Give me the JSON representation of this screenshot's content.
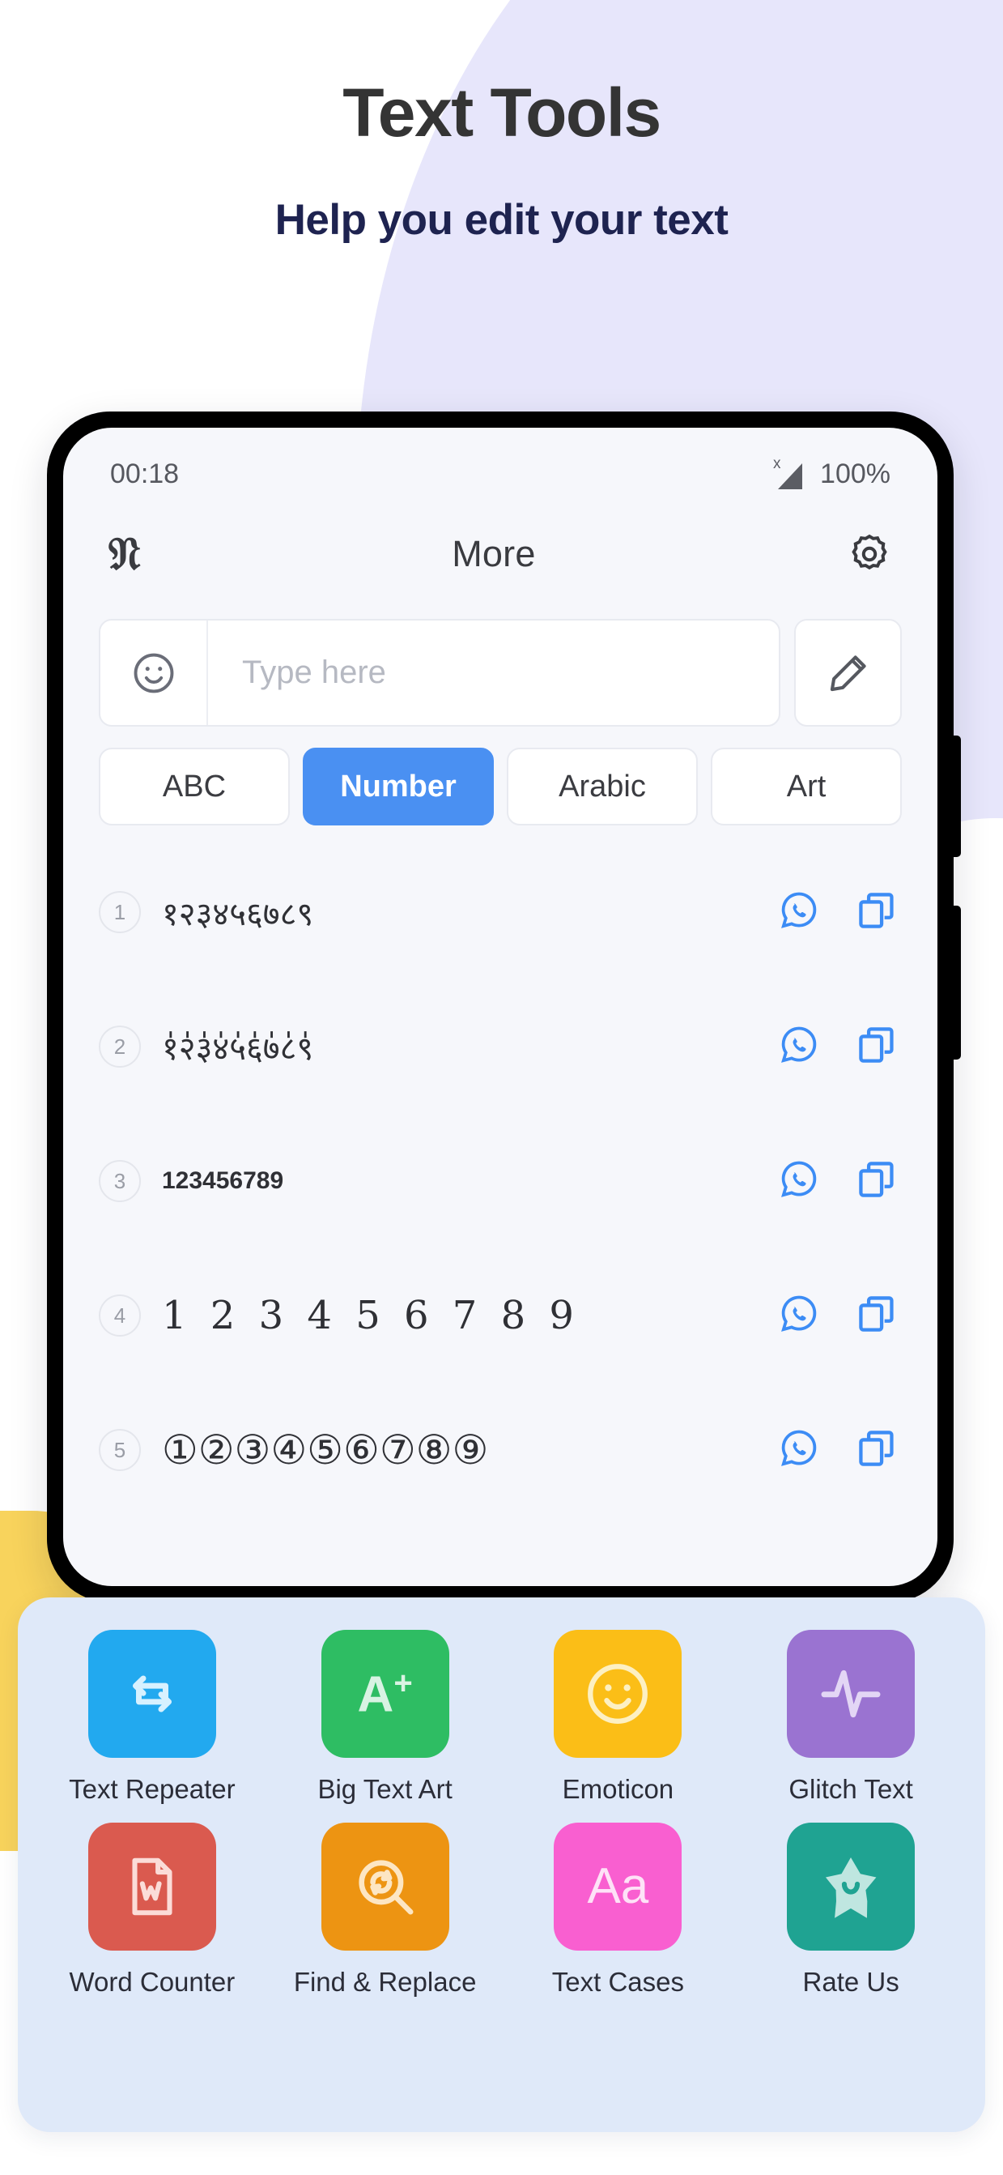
{
  "promo": {
    "headline": "Text Tools",
    "subhead": "Help you edit your text",
    "headline_color": "#343434",
    "subhead_color": "#1e2350",
    "bg_lavender": "#e7e6fb",
    "bg_yellow": "#f8d35c"
  },
  "status_bar": {
    "time": "00:18",
    "battery": "100%",
    "signal_icon": "signal-bars-icon",
    "signal_badge": "x"
  },
  "app_bar": {
    "logo": "F",
    "logo_icon": "fraktur-f-logo-icon",
    "title": "More",
    "settings_icon": "gear-icon"
  },
  "input": {
    "emoji_icon": "smiley-face-icon",
    "placeholder": "Type here",
    "value": "",
    "edit_icon": "pencil-icon"
  },
  "tabs": [
    {
      "label": "ABC",
      "active": false
    },
    {
      "label": "Number",
      "active": true
    },
    {
      "label": "Arabic",
      "active": false
    },
    {
      "label": "Art",
      "active": false
    }
  ],
  "tab_active_color": "#4a90f2",
  "rows": [
    {
      "index": "1",
      "text": "१२३४५६७८९",
      "style": "rt-deva"
    },
    {
      "index": "2",
      "text": "१॑२॑३॑४॑५॑६॑७॑८॑९॑",
      "style": "rt-deva2"
    },
    {
      "index": "3",
      "text": "123456789",
      "style": "rt-small"
    },
    {
      "index": "4",
      "text": "1 2 3 4 5 6 7 8 9",
      "style": "rt-serif"
    },
    {
      "index": "5",
      "text": "①②③④⑤⑥⑦⑧⑨",
      "style": "rt-circled"
    }
  ],
  "row_actions": {
    "whatsapp_icon": "whatsapp-share-icon",
    "copy_icon": "copy-icon",
    "action_color": "#3c8cf5"
  },
  "tools_panel": {
    "background": "#dfe9f9",
    "tools": [
      {
        "label": "Text Repeater",
        "icon": "repeat-arrows-icon",
        "color": "#22a9ef"
      },
      {
        "label": "Big Text Art",
        "icon": "a-plus-icon",
        "color": "#2ebd63"
      },
      {
        "label": "Emoticon",
        "icon": "smiley-face-icon",
        "color": "#fbbe17"
      },
      {
        "label": "Glitch Text",
        "icon": "waveform-icon",
        "color": "#9a73d1"
      },
      {
        "label": "Word Counter",
        "icon": "word-document-icon",
        "color": "#da5a4f"
      },
      {
        "label": "Find & Replace",
        "icon": "search-replace-icon",
        "color": "#ed9412"
      },
      {
        "label": "Text Cases",
        "icon": "letter-case-icon",
        "color": "#f95fd0"
      },
      {
        "label": "Rate Us",
        "icon": "star-ribbon-icon",
        "color": "#1fa392"
      }
    ]
  }
}
